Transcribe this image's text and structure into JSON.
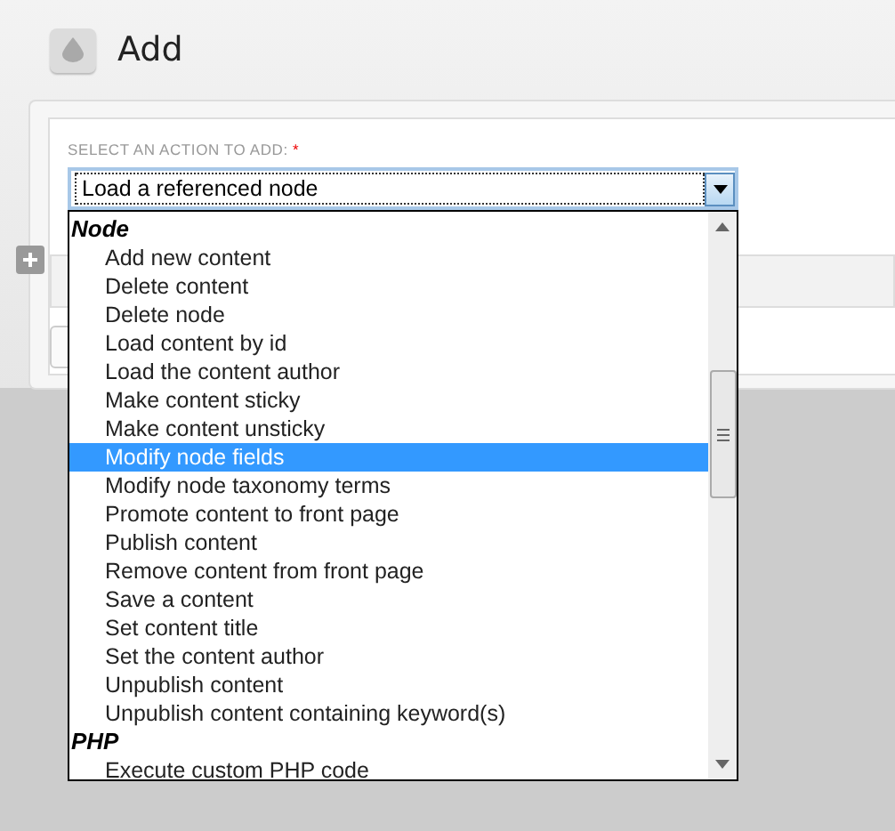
{
  "header": {
    "title": "Add"
  },
  "form": {
    "label": "SELECT AN ACTION TO ADD:",
    "required": true,
    "required_mark": "*",
    "select": {
      "value": "Load a referenced node",
      "open": true
    }
  },
  "dropdown": {
    "groups": [
      {
        "label": "Node",
        "items": [
          {
            "label": "Add new content",
            "selected": false
          },
          {
            "label": "Delete content",
            "selected": false
          },
          {
            "label": "Delete node",
            "selected": false
          },
          {
            "label": "Load content by id",
            "selected": false
          },
          {
            "label": "Load the content author",
            "selected": false
          },
          {
            "label": "Make content sticky",
            "selected": false
          },
          {
            "label": "Make content unsticky",
            "selected": false
          },
          {
            "label": "Modify node fields",
            "selected": true
          },
          {
            "label": "Modify node taxonomy terms",
            "selected": false
          },
          {
            "label": "Promote content to front page",
            "selected": false
          },
          {
            "label": "Publish content",
            "selected": false
          },
          {
            "label": "Remove content from front page",
            "selected": false
          },
          {
            "label": "Save a content",
            "selected": false
          },
          {
            "label": "Set content title",
            "selected": false
          },
          {
            "label": "Set the content author",
            "selected": false
          },
          {
            "label": "Unpublish content",
            "selected": false
          },
          {
            "label": "Unpublish content containing keyword(s)",
            "selected": false
          }
        ]
      },
      {
        "label": "PHP",
        "items": [
          {
            "label": "Execute custom PHP code",
            "selected": false
          }
        ]
      }
    ]
  }
}
